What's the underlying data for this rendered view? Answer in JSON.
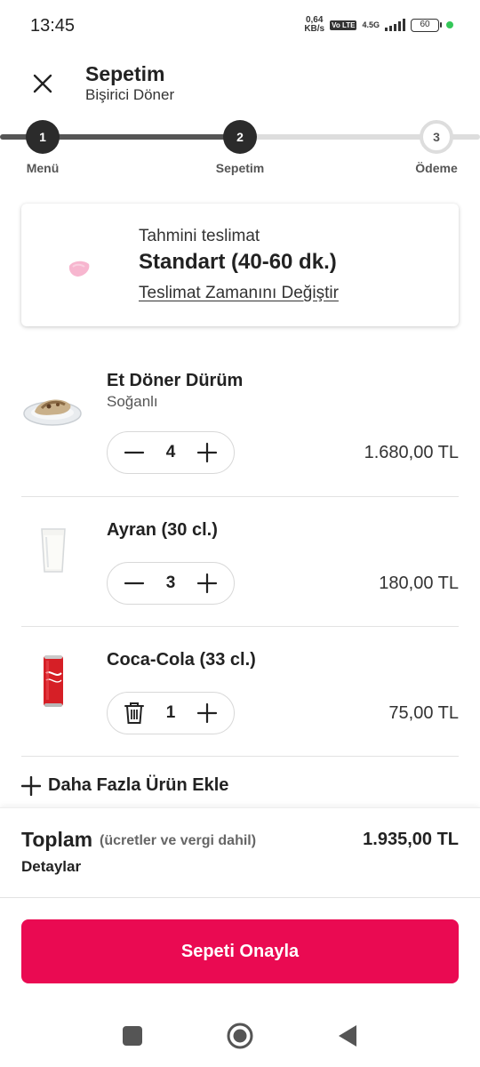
{
  "status_bar": {
    "time": "13:45",
    "net_speed_value": "0,64",
    "net_speed_unit": "KB/s",
    "volte": "Vo LTE",
    "network_type": "4.5G",
    "battery": "60"
  },
  "header": {
    "title": "Sepetim",
    "restaurant": "Bişirici Döner"
  },
  "stepper": {
    "steps": [
      {
        "number": "1",
        "label": "Menü"
      },
      {
        "number": "2",
        "label": "Sepetim"
      },
      {
        "number": "3",
        "label": "Ödeme"
      }
    ],
    "current_step": 2
  },
  "delivery": {
    "label": "Tahmini teslimat",
    "value": "Standart (40-60 dk.)",
    "change_link": "Teslimat Zamanını Değiştir"
  },
  "items": [
    {
      "name": "Et Döner Dürüm",
      "description": "Soğanlı",
      "quantity": "4",
      "price": "1.680,00 TL",
      "left_action_icon": "minus-icon"
    },
    {
      "name": "Ayran (30 cl.)",
      "quantity": "3",
      "price": "180,00 TL",
      "left_action_icon": "minus-icon"
    },
    {
      "name": "Coca-Cola (33 cl.)",
      "quantity": "1",
      "price": "75,00 TL",
      "left_action_icon": "trash-icon"
    }
  ],
  "add_more": {
    "label": "Daha Fazla Ürün Ekle"
  },
  "summary": {
    "total_label": "Toplam",
    "total_note": "(ücretler ve vergi dahil)",
    "total_value": "1.935,00 TL",
    "details_link": "Detaylar",
    "confirm_button": "Sepeti Onayla"
  },
  "colors": {
    "accent": "#ea0a52",
    "step_active": "#2b2b2b",
    "step_inactive": "#dddddd"
  }
}
